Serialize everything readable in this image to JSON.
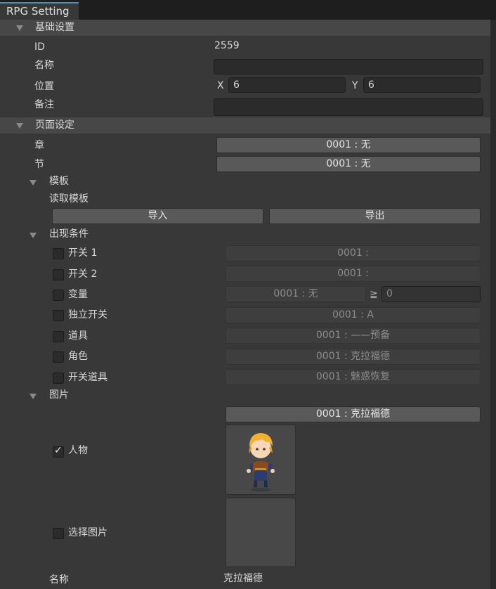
{
  "window": {
    "tab_title": "RPG Setting"
  },
  "basic": {
    "header": "基础设置",
    "id_label": "ID",
    "id_value": "2559",
    "name_label": "名称",
    "name_value": "",
    "pos_label": "位置",
    "x_label": "X",
    "x_value": "6",
    "y_label": "Y",
    "y_value": "6",
    "note_label": "备注",
    "note_value": ""
  },
  "page": {
    "header": "页面设定",
    "chapter_label": "章",
    "chapter_value": "0001 : 无",
    "section_label": "节",
    "section_value": "0001 : 无",
    "template": {
      "header": "模板",
      "read_label": "读取模板",
      "import_label": "导入",
      "export_label": "导出"
    },
    "conditions": {
      "header": "出现条件",
      "switch1_label": "开关 1",
      "switch1_value": "0001 :",
      "switch2_label": "开关 2",
      "switch2_value": "0001 :",
      "variable_label": "变量",
      "variable_value": "0001 : 无",
      "variable_op": "≧",
      "variable_compare": "0",
      "self_switch_label": "独立开关",
      "self_switch_value": "0001 : A",
      "item_label": "道具",
      "item_value": "0001 : ——预备",
      "actor_label": "角色",
      "actor_value": "0001 : 克拉福德",
      "switch_item_label": "开关道具",
      "switch_item_value": "0001 : 魅惑恢复"
    },
    "image": {
      "header": "图片",
      "actor_select": "0001 : 克拉福德",
      "character_label": "人物",
      "character_checked": true,
      "choose_label": "选择图片",
      "choose_checked": false,
      "name_label": "名称",
      "name_value": "克拉福德"
    }
  },
  "colors": {
    "hair": "#f0b030",
    "outfit": "#2c3c70",
    "vest": "#8a4a20",
    "accent": "#4a8ad4"
  }
}
